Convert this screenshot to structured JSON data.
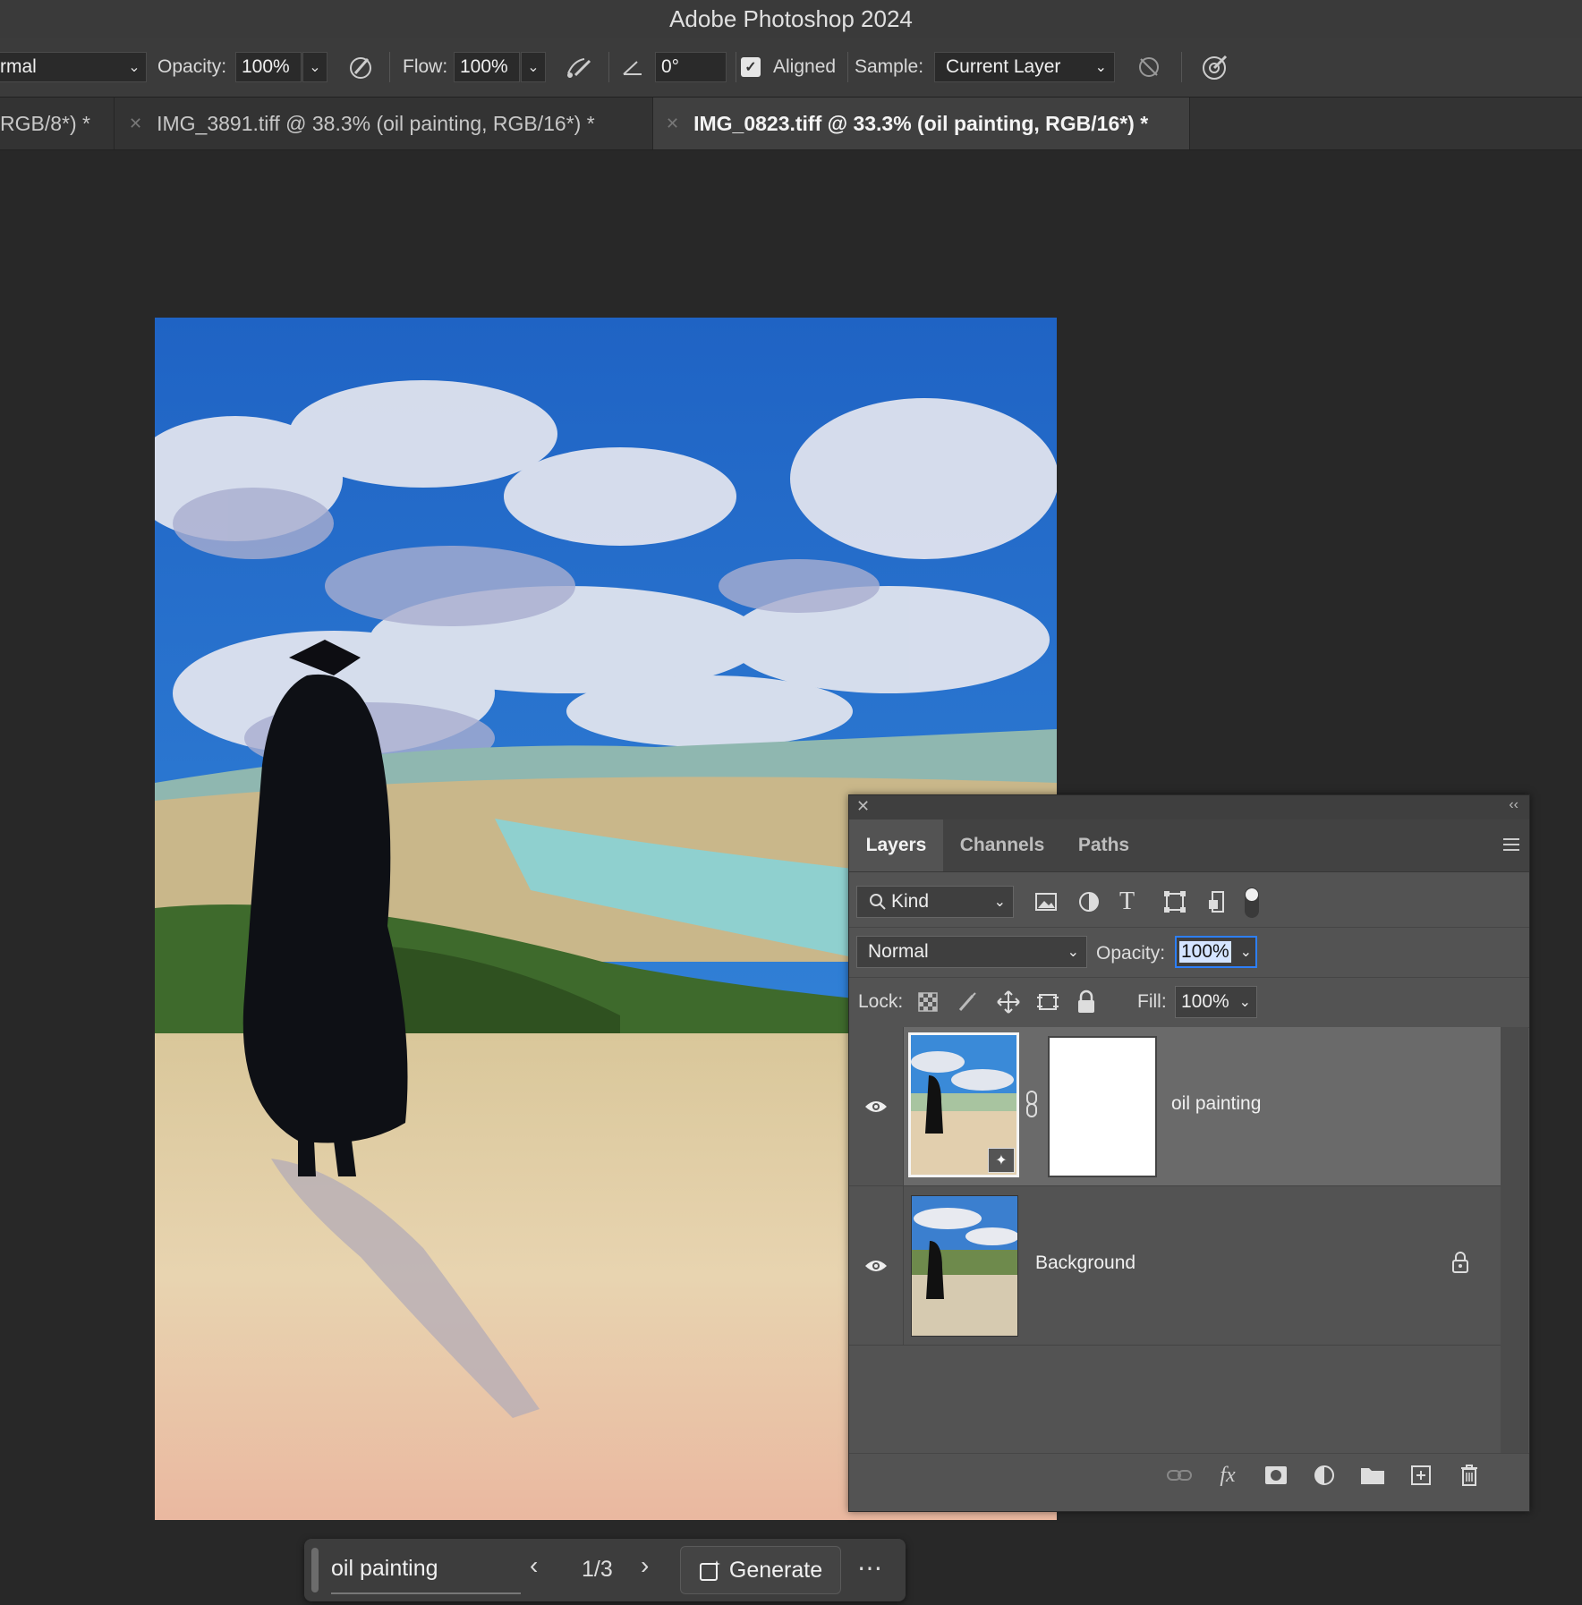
{
  "app": {
    "title": "Adobe Photoshop 2024"
  },
  "options": {
    "mode_value": "rmal",
    "opacity_label": "Opacity:",
    "opacity_value": "100%",
    "flow_label": "Flow:",
    "flow_value": "100%",
    "angle_value": "0°",
    "aligned_label": "Aligned",
    "aligned_checked": true,
    "sample_label": "Sample:",
    "sample_value": "Current Layer"
  },
  "tabs": [
    {
      "label": "RGB/8*) *"
    },
    {
      "label": "IMG_3891.tiff @ 38.3% (oil painting, RGB/16*) *"
    },
    {
      "label": "IMG_0823.tiff @ 33.3% (oil painting, RGB/16*) *",
      "active": true
    }
  ],
  "layers_panel": {
    "tabs": [
      "Layers",
      "Channels",
      "Paths"
    ],
    "filter_value": "Kind",
    "blend_mode": "Normal",
    "opacity_label": "Opacity:",
    "opacity_value": "100%",
    "lock_label": "Lock:",
    "fill_label": "Fill:",
    "fill_value": "100%",
    "layers": [
      {
        "name": "oil painting",
        "visible": true,
        "selected": true,
        "has_mask": true
      },
      {
        "name": "Background",
        "visible": true,
        "locked": true
      }
    ]
  },
  "context_bar": {
    "prompt_value": "oil painting",
    "variation_counter": "1/3",
    "generate_label": "Generate"
  },
  "colors": {
    "accent": "#2d7ff9",
    "panel": "#535353",
    "selected_layer": "#6a6a6a"
  }
}
